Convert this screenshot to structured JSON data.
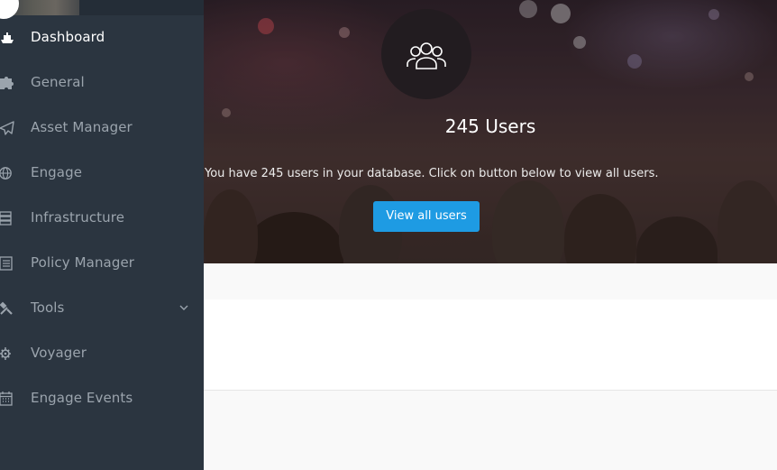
{
  "sidebar": {
    "items": [
      {
        "label": "Dashboard",
        "icon": "boat-icon",
        "active": true
      },
      {
        "label": "General",
        "icon": "puzzle-icon",
        "active": false
      },
      {
        "label": "Asset Manager",
        "icon": "paper-plane-icon",
        "active": false
      },
      {
        "label": "Engage",
        "icon": "globe-icon",
        "active": false
      },
      {
        "label": "Infrastructure",
        "icon": "server-icon",
        "active": false
      },
      {
        "label": "Policy Manager",
        "icon": "document-icon",
        "active": false
      },
      {
        "label": "Tools",
        "icon": "tools-icon",
        "active": false,
        "has_submenu": true
      },
      {
        "label": "Voyager",
        "icon": "helm-icon",
        "active": false
      },
      {
        "label": "Engage Events",
        "icon": "calendar-icon",
        "active": false
      }
    ]
  },
  "hero": {
    "icon": "users-icon",
    "title": "245 Users",
    "description": "You have 245 users in your database. Click on button below to view all users.",
    "button_label": "View all users"
  },
  "colors": {
    "sidebar_bg": "#2b3540",
    "sidebar_text": "#9ba4ad",
    "active_text": "#ffffff",
    "button_bg": "#1e9be3",
    "content_bg": "#f9f9f9"
  }
}
